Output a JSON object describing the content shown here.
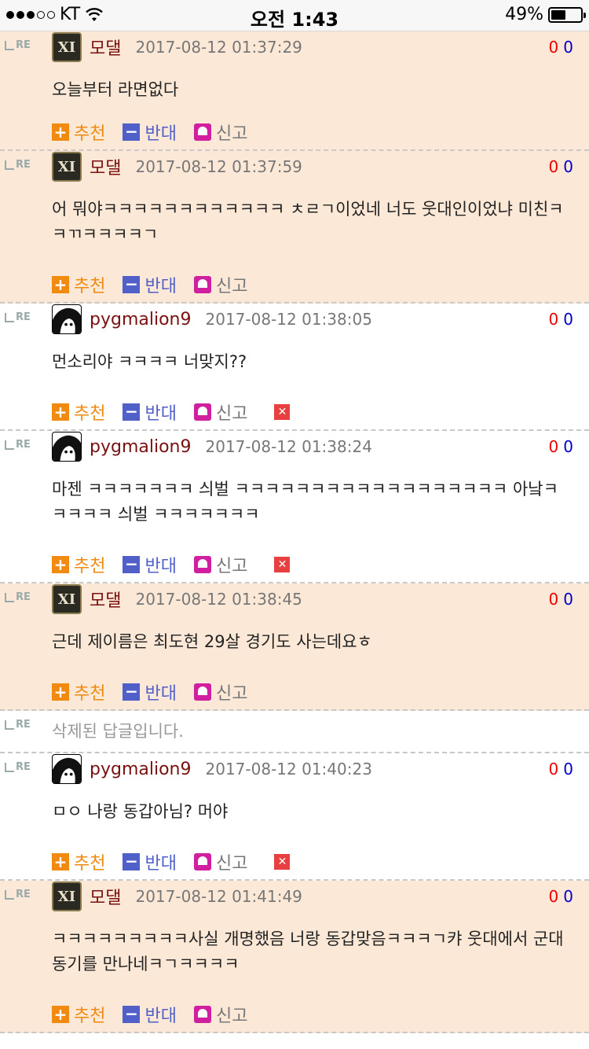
{
  "status_bar": {
    "carrier": "KT",
    "time": "오전 1:43",
    "battery": "49%",
    "battery_level": 0.49
  },
  "labels": {
    "recommend": "추천",
    "oppose": "반대",
    "report": "신고",
    "re": "RE"
  },
  "comments": [
    {
      "author": "모댈",
      "avatar": "xi",
      "date": "2017-08-12 01:37:29",
      "up": "0",
      "down": "0",
      "text": "오늘부터 라면없다",
      "highlight": true,
      "deletable": false
    },
    {
      "author": "모댈",
      "avatar": "xi",
      "date": "2017-08-12 01:37:59",
      "up": "0",
      "down": "0",
      "text": "어 뭐야ㅋㅋㅋㅋㅋㅋㅋㅋㅋㅋㅋㅋ ㅊㄹㄱ이었네 너도 웃대인이었냐 미친ㅋㅋㄲㅋㅋㅋㅋㄱ",
      "highlight": true,
      "deletable": false
    },
    {
      "author": "pygmalion9",
      "avatar": "pyg",
      "date": "2017-08-12 01:38:05",
      "up": "0",
      "down": "0",
      "text": "먼소리야 ㅋㅋㅋㅋ 너맞지??",
      "highlight": false,
      "deletable": true
    },
    {
      "author": "pygmalion9",
      "avatar": "pyg",
      "date": "2017-08-12 01:38:24",
      "up": "0",
      "down": "0",
      "text": "마젠 ㅋㅋㅋㅋㅋㅋㅋ 싀벌 ㅋㅋㅋㅋㅋㅋㅋㅋㅋㅋㅋㅋㅋㅋㅋㅋㅋㅋ 아낰ㅋㅋㅋㅋㅋ 싀벌 ㅋㅋㅋㅋㅋㅋㅋ",
      "highlight": false,
      "deletable": true
    },
    {
      "author": "모댈",
      "avatar": "xi",
      "date": "2017-08-12 01:38:45",
      "up": "0",
      "down": "0",
      "text": "근데 제이름은 최도현 29살 경기도 사는데요ㅎ",
      "highlight": true,
      "deletable": false
    },
    {
      "deleted": true,
      "text": "삭제된 답글입니다."
    },
    {
      "author": "pygmalion9",
      "avatar": "pyg",
      "date": "2017-08-12 01:40:23",
      "up": "0",
      "down": "0",
      "text": "ㅁㅇ 나랑 동갑아님? 머야",
      "highlight": false,
      "deletable": true
    },
    {
      "author": "모댈",
      "avatar": "xi",
      "date": "2017-08-12 01:41:49",
      "up": "0",
      "down": "0",
      "text": "ㅋㅋㅋㅋㅋㅋㅋㅋㅋ사실 개명했음 너랑 동갑맞음ㅋㅋㅋㄱ캬 웃대에서 군대동기를 만나네ㅋㄱㅋㅋㅋㅋ",
      "highlight": true,
      "deletable": false
    }
  ]
}
